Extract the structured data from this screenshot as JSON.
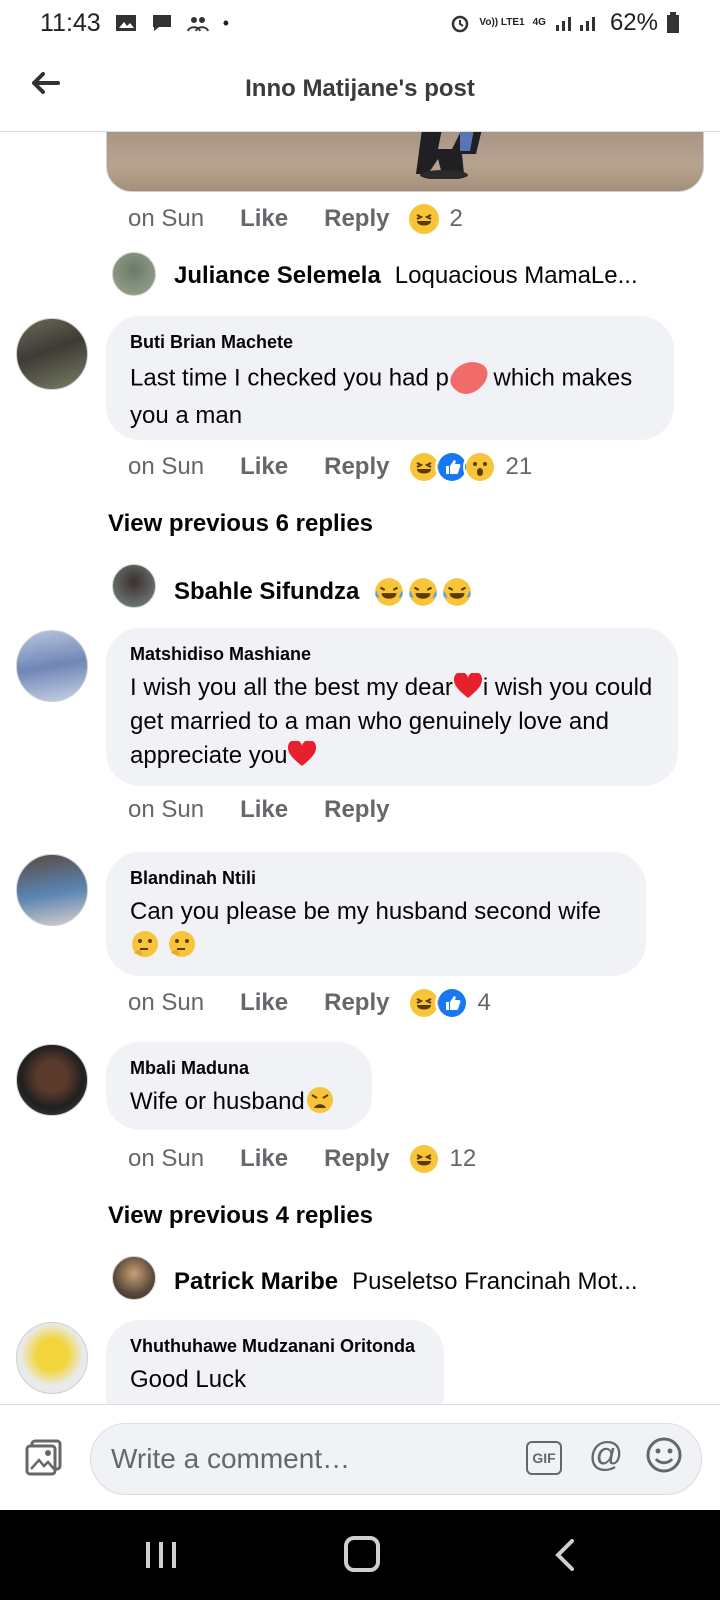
{
  "status_bar": {
    "time": "11:43",
    "battery": "62%",
    "network": "4G",
    "volte": "Vo)) LTE1"
  },
  "header": {
    "title": "Inno Matijane's post",
    "back_icon": "arrow-left-icon"
  },
  "comments": {
    "post_photo_actions": {
      "time": "on Sun",
      "like": "Like",
      "reply": "Reply",
      "reactions": [
        "haha"
      ],
      "count": "2"
    },
    "reply_preview_1": {
      "name": "Juliance Selemela",
      "text": "Loquacious MamaLe..."
    },
    "comment_1": {
      "name": "Buti Brian Machete",
      "text_a": "Last time I checked you had p",
      "text_b": " which makes you a man",
      "time": "on Sun",
      "like": "Like",
      "reply": "Reply",
      "reactions": [
        "haha",
        "like",
        "wow"
      ],
      "count": "21"
    },
    "view_previous_1": "View previous 6 replies",
    "reply_preview_2": {
      "name": "Sbahle Sifundza",
      "emojis": [
        "laughing-tears",
        "laughing-tears",
        "laughing-tears"
      ]
    },
    "comment_2": {
      "name": "Matshidiso Mashiane",
      "text_a": "I wish you all the best my dear",
      "text_b": "i wish you could get married to a man who genuinely love and appreciate you",
      "time": "on Sun",
      "like": "Like",
      "reply": "Reply"
    },
    "comment_3": {
      "name": "Blandinah Ntili",
      "text": "Can you please be my husband second wife",
      "time": "on Sun",
      "like": "Like",
      "reply": "Reply",
      "reactions": [
        "haha",
        "like"
      ],
      "count": "4"
    },
    "comment_4": {
      "name": "Mbali Maduna",
      "text": "Wife or husband",
      "time": "on Sun",
      "like": "Like",
      "reply": "Reply",
      "reactions": [
        "haha"
      ],
      "count": "12"
    },
    "view_previous_2": "View previous 4 replies",
    "reply_preview_3": {
      "name": "Patrick Maribe",
      "text": "Puseletso Francinah Mot..."
    },
    "comment_5": {
      "name": "Vhuthuhawe Mudzanani Oritonda",
      "text": "Good Luck"
    }
  },
  "composer": {
    "placeholder": "Write a comment…",
    "gif_label": "GIF",
    "at_label": "@"
  },
  "colors": {
    "bubble": "#f0f2f5",
    "secondary_text": "#65676b",
    "like_blue": "#1877f2",
    "haha_yellow": "#f7c43a"
  }
}
